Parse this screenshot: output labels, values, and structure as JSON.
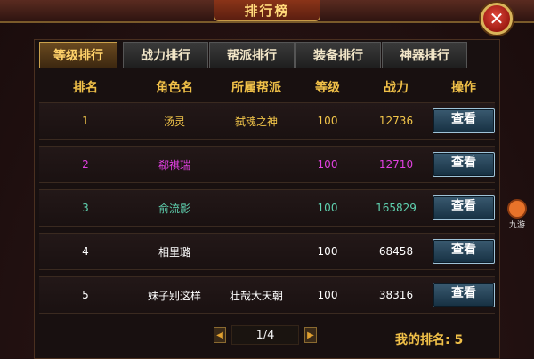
{
  "window": {
    "title": "排行榜",
    "close_icon": "close-icon"
  },
  "tabs": [
    {
      "label": "等级排行",
      "active": true
    },
    {
      "label": "战力排行",
      "active": false
    },
    {
      "label": "帮派排行",
      "active": false
    },
    {
      "label": "装备排行",
      "active": false
    },
    {
      "label": "神器排行",
      "active": false
    }
  ],
  "table": {
    "headers": [
      "排名",
      "角色名",
      "所属帮派",
      "等级",
      "战力",
      "操作"
    ],
    "rows": [
      {
        "rank": "1",
        "name": "汤灵",
        "guild": "弑魂之神",
        "level": "100",
        "power": "12736",
        "action": "查看",
        "color": "#f3c64a"
      },
      {
        "rank": "2",
        "name": "郗祺瑞",
        "guild": "",
        "level": "100",
        "power": "12710",
        "action": "查看",
        "color": "#e040e0"
      },
      {
        "rank": "3",
        "name": "俞流影",
        "guild": "",
        "level": "100",
        "power": "165829",
        "action": "查看",
        "color": "#5fd2b0"
      },
      {
        "rank": "4",
        "name": "相里璐",
        "guild": "",
        "level": "100",
        "power": "68458",
        "action": "查看",
        "color": "#ffffff"
      },
      {
        "rank": "5",
        "name": "妹子别这样",
        "guild": "壮哉大天朝",
        "level": "100",
        "power": "38316",
        "action": "查看",
        "color": "#ffffff"
      }
    ]
  },
  "pager": {
    "text": "1/4",
    "prev_icon": "triangle-left-icon",
    "next_icon": "triangle-right-icon"
  },
  "my_rank": {
    "text": "我的排名: 5"
  },
  "side_widget": {
    "label": "九游"
  }
}
